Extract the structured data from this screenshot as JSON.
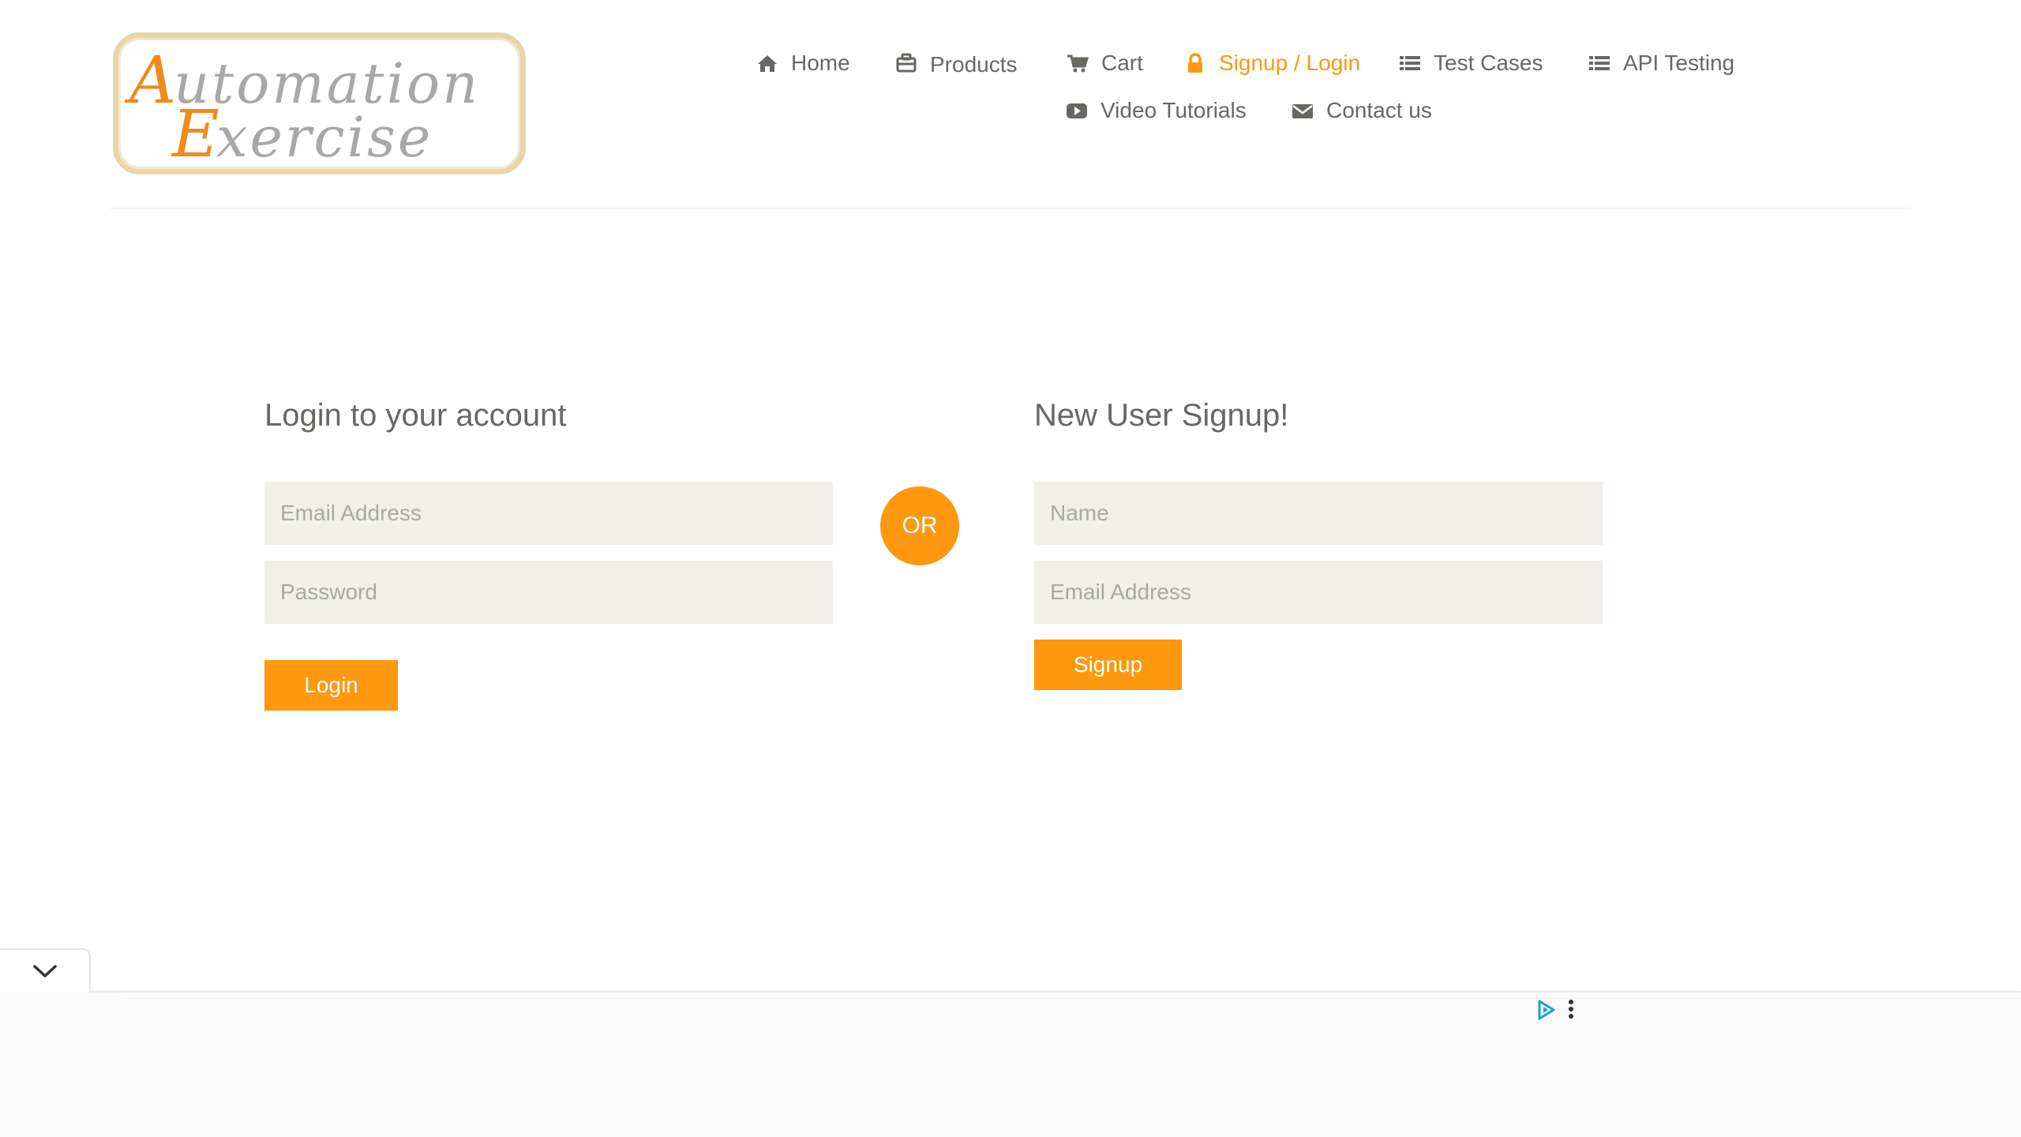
{
  "logo": {
    "line1": "Automation",
    "line2": "Exercise"
  },
  "nav": {
    "items": [
      {
        "label": "Home",
        "icon": "home-icon"
      },
      {
        "label": "Products",
        "icon": "briefcase-icon"
      },
      {
        "label": "Cart",
        "icon": "cart-icon"
      },
      {
        "label": "Signup / Login",
        "icon": "lock-icon",
        "active": true
      },
      {
        "label": "Test Cases",
        "icon": "list-icon"
      },
      {
        "label": "API Testing",
        "icon": "list-icon"
      },
      {
        "label": "Video Tutorials",
        "icon": "youtube-play-icon"
      },
      {
        "label": "Contact us",
        "icon": "envelope-icon"
      }
    ]
  },
  "login": {
    "title": "Login to your account",
    "email_placeholder": "Email Address",
    "password_placeholder": "Password",
    "button_label": "Login"
  },
  "or_label": "OR",
  "signup": {
    "title": "New User Signup!",
    "name_placeholder": "Name",
    "email_placeholder": "Email Address",
    "button_label": "Signup"
  },
  "ad": {
    "toggle_icon": "chevron-down-icon",
    "adchoices_icon": "adchoices-icon",
    "menu_icon": "more-vertical-icon"
  },
  "colors": {
    "accent": "#fe980f",
    "text": "#696763",
    "input_bg": "#f0f0e9"
  }
}
